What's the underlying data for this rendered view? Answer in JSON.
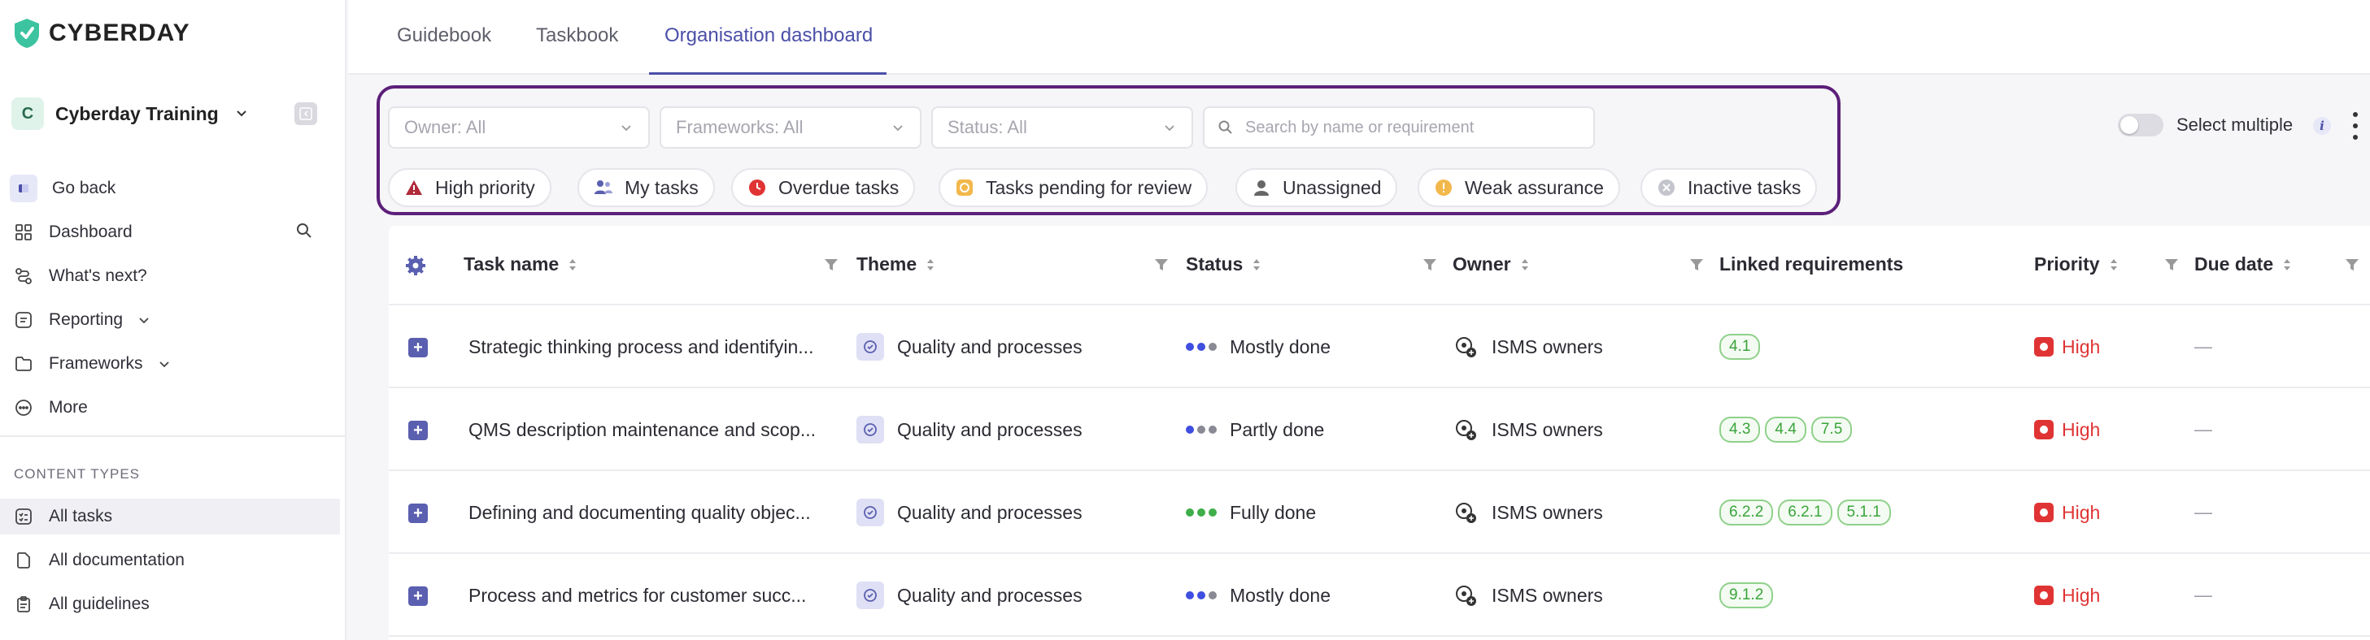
{
  "brand": {
    "name": "CYBERDAY",
    "accent": "#4b4fa8",
    "panel_border": "#5c1f7a"
  },
  "workspace": {
    "initial": "C",
    "name": "Cyberday Training"
  },
  "sidebar": {
    "go_back": "Go back",
    "items": [
      {
        "label": "Dashboard",
        "icon": "grid-icon"
      },
      {
        "label": "What's next?",
        "icon": "route-icon"
      },
      {
        "label": "Reporting",
        "icon": "report-icon"
      },
      {
        "label": "Frameworks",
        "icon": "folder-icon"
      },
      {
        "label": "More",
        "icon": "more-icon"
      }
    ],
    "section_label": "CONTENT TYPES",
    "content_types": [
      {
        "label": "All tasks",
        "icon": "tasks-icon",
        "active": true
      },
      {
        "label": "All documentation",
        "icon": "document-icon"
      },
      {
        "label": "All guidelines",
        "icon": "clipboard-icon"
      }
    ]
  },
  "tabs": [
    {
      "label": "Guidebook"
    },
    {
      "label": "Taskbook"
    },
    {
      "label": "Organisation dashboard",
      "active": true
    }
  ],
  "filters": {
    "owner": "Owner: All",
    "frameworks": "Frameworks: All",
    "status": "Status: All",
    "search_placeholder": "Search by name or requirement",
    "chips": [
      {
        "label": "High priority",
        "icon": "warning-icon"
      },
      {
        "label": "My tasks",
        "icon": "users-icon"
      },
      {
        "label": "Overdue tasks",
        "icon": "clock-icon"
      },
      {
        "label": "Tasks pending for review",
        "icon": "review-icon"
      },
      {
        "label": "Unassigned",
        "icon": "user-icon"
      },
      {
        "label": "Weak assurance",
        "icon": "alert-circle-icon"
      },
      {
        "label": "Inactive tasks",
        "icon": "x-circle-icon"
      }
    ]
  },
  "select_multiple": "Select multiple",
  "table": {
    "columns": [
      "Task name",
      "Theme",
      "Status",
      "Owner",
      "Linked requirements",
      "Priority",
      "Due date"
    ],
    "rows": [
      {
        "name": "Strategic thinking process and identifyin...",
        "theme": "Quality and processes",
        "status": "Mostly done",
        "dots": [
          "#3f4fe0",
          "#3f4fe0",
          "#8a8a95"
        ],
        "owner": "ISMS owners",
        "requirements": [
          "4.1"
        ],
        "priority": "High",
        "due": "—"
      },
      {
        "name": "QMS description maintenance and scop...",
        "theme": "Quality and processes",
        "status": "Partly done",
        "dots": [
          "#3f4fe0",
          "#8a8a95",
          "#8a8a95"
        ],
        "owner": "ISMS owners",
        "requirements": [
          "4.3",
          "4.4",
          "7.5"
        ],
        "priority": "High",
        "due": "—"
      },
      {
        "name": "Defining and documenting quality objec...",
        "theme": "Quality and processes",
        "status": "Fully done",
        "dots": [
          "#3fae4a",
          "#3fae4a",
          "#3fae4a"
        ],
        "owner": "ISMS owners",
        "requirements": [
          "6.2.2",
          "6.2.1",
          "5.1.1"
        ],
        "priority": "High",
        "due": "—"
      },
      {
        "name": "Process and metrics for customer succ...",
        "theme": "Quality and processes",
        "status": "Mostly done",
        "dots": [
          "#3f4fe0",
          "#3f4fe0",
          "#8a8a95"
        ],
        "owner": "ISMS owners",
        "requirements": [
          "9.1.2"
        ],
        "priority": "High",
        "due": "—"
      }
    ]
  }
}
